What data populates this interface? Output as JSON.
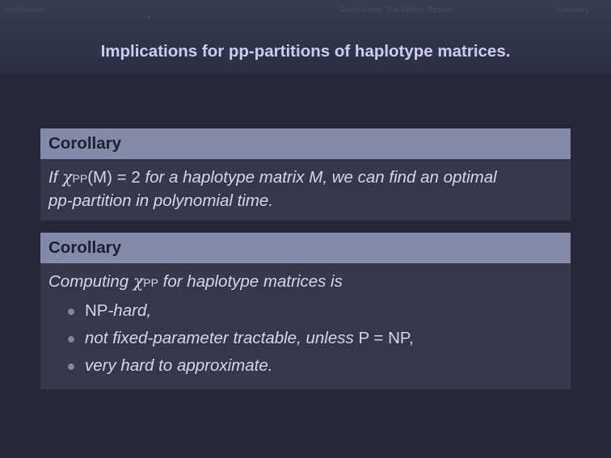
{
  "navbar": {
    "sections": [
      "Introduction",
      "Good News: Tractability Results",
      "Summary"
    ]
  },
  "frame": {
    "title": "Implications for pp-partitions of haplotype matrices."
  },
  "corollary1": {
    "heading": "Corollary",
    "text_if": "If",
    "chi": "χ",
    "chi_sub": "PP",
    "expr_rest": "(M) = 2",
    "line1_rest": "for a haplotype matrix M, we can find an optimal",
    "line2": "pp-partition in polynomial time."
  },
  "corollary2": {
    "heading": "Corollary",
    "intro_pre": "Computing",
    "chi": "χ",
    "chi_sub": "PP",
    "intro_post": "for haplotype matrices is",
    "items": [
      {
        "math": "NP",
        "text": "-hard,"
      },
      {
        "text": "not fixed-parameter tractable, unless",
        "math": "P = NP",
        "tail": ","
      },
      {
        "text": "very hard to approximate."
      }
    ]
  }
}
